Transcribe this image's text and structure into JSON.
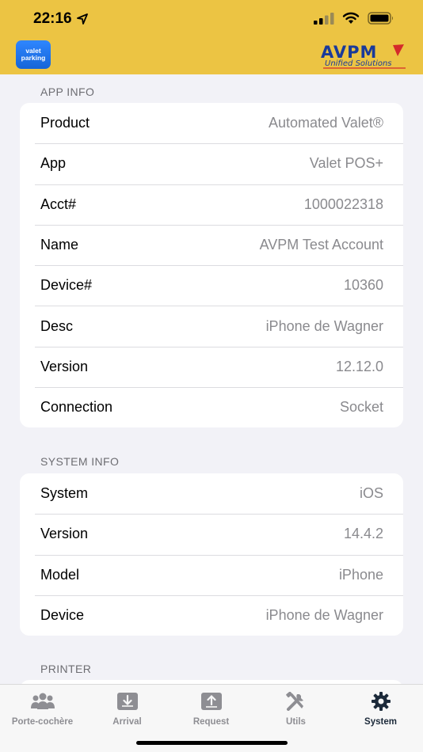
{
  "status": {
    "time": "22:16"
  },
  "header": {
    "app_logo_line1": "valet",
    "app_logo_line2": "parking",
    "brand_name": "AVPM",
    "brand_tagline": "Unified Solutions"
  },
  "app_info": {
    "title": "APP INFO",
    "rows": [
      {
        "label": "Product",
        "value": "Automated Valet®"
      },
      {
        "label": "App",
        "value": "Valet POS+"
      },
      {
        "label": "Acct#",
        "value": "1000022318"
      },
      {
        "label": "Name",
        "value": "AVPM Test Account"
      },
      {
        "label": "Device#",
        "value": "10360"
      },
      {
        "label": "Desc",
        "value": "iPhone de Wagner"
      },
      {
        "label": "Version",
        "value": "12.12.0"
      },
      {
        "label": "Connection",
        "value": "Socket"
      }
    ]
  },
  "system_info": {
    "title": "SYSTEM INFO",
    "rows": [
      {
        "label": "System",
        "value": "iOS"
      },
      {
        "label": "Version",
        "value": "14.4.2"
      },
      {
        "label": "Model",
        "value": "iPhone"
      },
      {
        "label": "Device",
        "value": "iPhone de Wagner"
      }
    ]
  },
  "printer": {
    "title": "PRINTER"
  },
  "tabbar": {
    "tabs": [
      {
        "label": "Porte-cochère",
        "icon": "people-icon"
      },
      {
        "label": "Arrival",
        "icon": "download-icon"
      },
      {
        "label": "Request",
        "icon": "upload-icon"
      },
      {
        "label": "Utils",
        "icon": "tools-icon"
      },
      {
        "label": "System",
        "icon": "gear-icon",
        "active": true
      }
    ]
  },
  "colors": {
    "header_bg": "#ecc443",
    "brand_blue": "#1a3a9a",
    "brand_red": "#d42a2a",
    "active_tab": "#1c2a3a",
    "inactive_tab": "#8e8e93"
  }
}
